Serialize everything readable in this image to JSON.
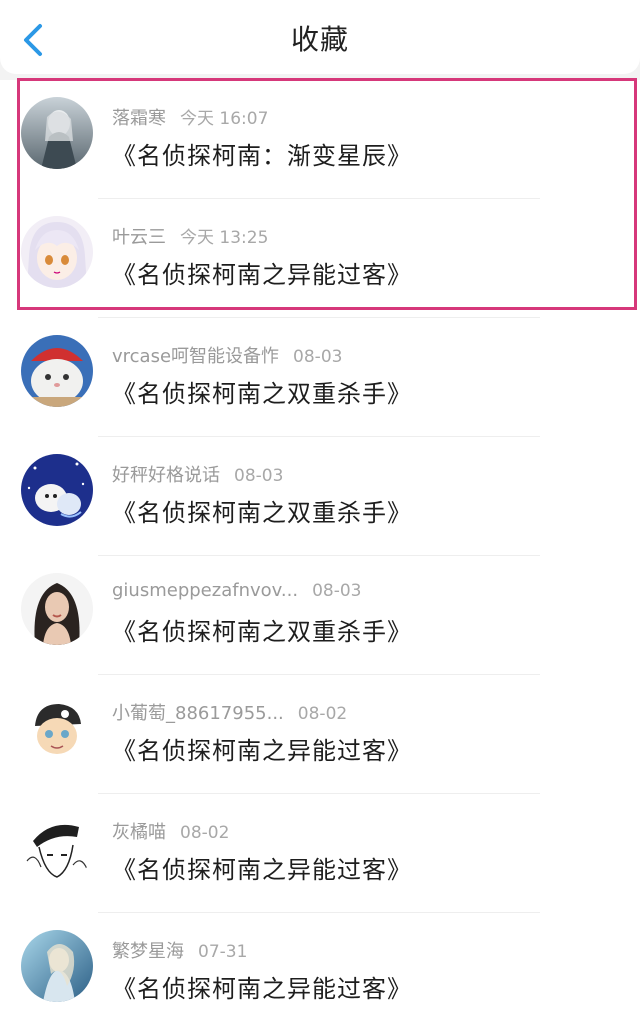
{
  "header": {
    "title": "收藏",
    "back_icon": "chevron-left-icon",
    "accent": "#2b98e6"
  },
  "items": [
    {
      "user": "落霜寒",
      "time": "今天 16:07",
      "book": "《名侦探柯南：渐变星辰》"
    },
    {
      "user": "叶云三",
      "time": "今天 13:25",
      "book": "《名侦探柯南之异能过客》"
    },
    {
      "user": "vrcase呵智能设备怍",
      "time": "08-03",
      "book": "《名侦探柯南之双重杀手》"
    },
    {
      "user": "好秤好格说话",
      "time": "08-03",
      "book": "《名侦探柯南之双重杀手》"
    },
    {
      "user": "giusmeppezafnvov...",
      "time": "08-03",
      "book": "《名侦探柯南之双重杀手》"
    },
    {
      "user": "小葡萄_88617955...",
      "time": "08-02",
      "book": "《名侦探柯南之异能过客》"
    },
    {
      "user": "灰橘喵",
      "time": "08-02",
      "book": "《名侦探柯南之异能过客》"
    },
    {
      "user": "繁梦星海",
      "time": "07-31",
      "book": "《名侦探柯南之异能过客》"
    }
  ],
  "highlight_color": "#d6387a"
}
